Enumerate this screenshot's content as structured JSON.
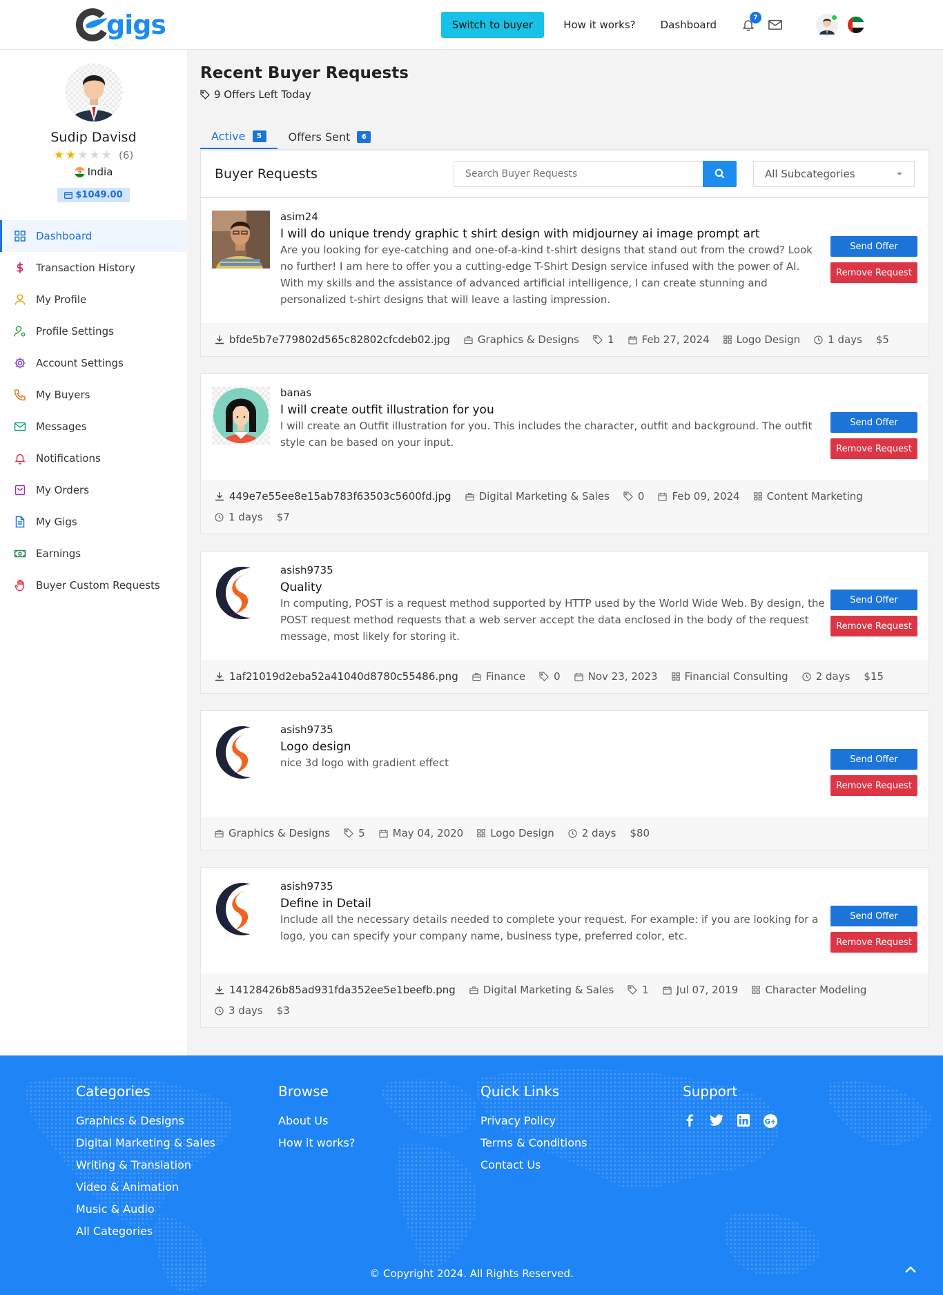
{
  "header": {
    "logo_text": "gigs",
    "switch_button": "Switch to buyer",
    "nav": [
      "How it works?",
      "Dashboard"
    ],
    "notifications_count": "7"
  },
  "profile": {
    "name": "Sudip Davisd",
    "rating": 2,
    "rating_max": 5,
    "rating_count": "(6)",
    "country": "India",
    "balance": "$1049.00"
  },
  "sidebar": {
    "items": [
      {
        "label": "Dashboard",
        "icon": "grid-icon",
        "active": true
      },
      {
        "label": "Transaction History",
        "icon": "dollar-icon"
      },
      {
        "label": "My Profile",
        "icon": "user-icon"
      },
      {
        "label": "Profile Settings",
        "icon": "user-gear-icon"
      },
      {
        "label": "Account Settings",
        "icon": "gear-icon"
      },
      {
        "label": "My Buyers",
        "icon": "phone-icon"
      },
      {
        "label": "Messages",
        "icon": "mail-icon"
      },
      {
        "label": "Notifications",
        "icon": "bell-icon"
      },
      {
        "label": "My Orders",
        "icon": "bag-icon"
      },
      {
        "label": "My Gigs",
        "icon": "document-icon"
      },
      {
        "label": "Earnings",
        "icon": "cash-icon"
      },
      {
        "label": "Buyer Custom Requests",
        "icon": "hand-icon"
      }
    ]
  },
  "main": {
    "title": "Recent Buyer Requests",
    "offers_left": "9 Offers Left Today",
    "tabs": [
      {
        "label": "Active",
        "count": "5",
        "active": true
      },
      {
        "label": "Offers Sent",
        "count": "6"
      }
    ],
    "card_title": "Buyer Requests",
    "search_placeholder": "Search Buyer Requests",
    "subcategory": "All Subcategories",
    "send_offer": "Send Offer",
    "remove_request": "Remove Request"
  },
  "requests": [
    {
      "user": "asim24",
      "avatar": "photo",
      "title": "I will do unique trendy graphic t shirt design with midjourney ai image prompt art",
      "description": "Are you looking for eye-catching and one-of-a-kind t-shirt designs that stand out from the crowd? Look no further! I am here to offer you a cutting-edge T-Shirt Design service infused with the power of AI. With my skills and the assistance of advanced artificial intelligence, I can create stunning and personalized t-shirt designs that will leave a lasting impression.",
      "file": "bfde5b7e779802d565c82802cfcdeb02.jpg",
      "category": "Graphics & Designs",
      "offers": "1",
      "date": "Feb 27, 2024",
      "subcategory": "Logo Design",
      "duration": "1 days",
      "budget": "$5"
    },
    {
      "user": "banas",
      "avatar": "girl",
      "title": "I will create outfit illustration for you",
      "description": "I will create an Outfit illustration for you. This includes the character, outfit and background. The outfit style can be based on your input.",
      "file": "449e7e55ee8e15ab783f63503c5600fd.jpg",
      "category": "Digital Marketing & Sales",
      "offers": "0",
      "date": "Feb 09, 2024",
      "subcategory": "Content Marketing",
      "duration": "1 days",
      "budget": "$7"
    },
    {
      "user": "asish9735",
      "avatar": "logo",
      "title": "Quality",
      "description": "In computing, POST is a request method supported by HTTP used by the World Wide Web. By design, the POST request method requests that a web server accept the data enclosed in the body of the request message, most likely for storing it.",
      "file": "1af21019d2eba52a41040d8780c55486.png",
      "category": "Finance",
      "offers": "0",
      "date": "Nov 23, 2023",
      "subcategory": "Financial Consulting",
      "duration": "2 days",
      "budget": "$15"
    },
    {
      "user": "asish9735",
      "avatar": "logo",
      "title": "Logo design",
      "description": "nice 3d logo with gradient effect",
      "file": "",
      "category": "Graphics & Designs",
      "offers": "5",
      "date": "May 04, 2020",
      "subcategory": "Logo Design",
      "duration": "2 days",
      "budget": "$80"
    },
    {
      "user": "asish9735",
      "avatar": "logo",
      "title": "Define in Detail",
      "description": "Include all the necessary details needed to complete your request. For example: if you are looking for a logo, you can specify your company name, business type, preferred color, etc.",
      "file": "14128426b85ad931fda352ee5e1beefb.png",
      "category": "Digital Marketing & Sales",
      "offers": "1",
      "date": "Jul 07, 2019",
      "subcategory": "Character Modeling",
      "duration": "3 days",
      "budget": "$3"
    }
  ],
  "footer": {
    "columns": [
      {
        "title": "Categories",
        "links": [
          "Graphics & Designs",
          "Digital Marketing & Sales",
          "Writing & Translation",
          "Video & Animation",
          "Music & Audio",
          "All Categories"
        ]
      },
      {
        "title": "Browse",
        "links": [
          "About Us",
          "How it works?"
        ]
      },
      {
        "title": "Quick Links",
        "links": [
          "Privacy Policy",
          "Terms & Conditions",
          "Contact Us"
        ]
      },
      {
        "title": "Support",
        "links": []
      }
    ],
    "socials": [
      "facebook-icon",
      "twitter-icon",
      "linkedin-icon",
      "google-plus-icon"
    ],
    "copyright": "© Copyright 2024. All Rights Reserved."
  },
  "colors": {
    "primary": "#1d74d8",
    "accent": "#17c2e6",
    "danger": "#dc3545",
    "footer": "#1f84f5",
    "star": "#f5b301"
  }
}
